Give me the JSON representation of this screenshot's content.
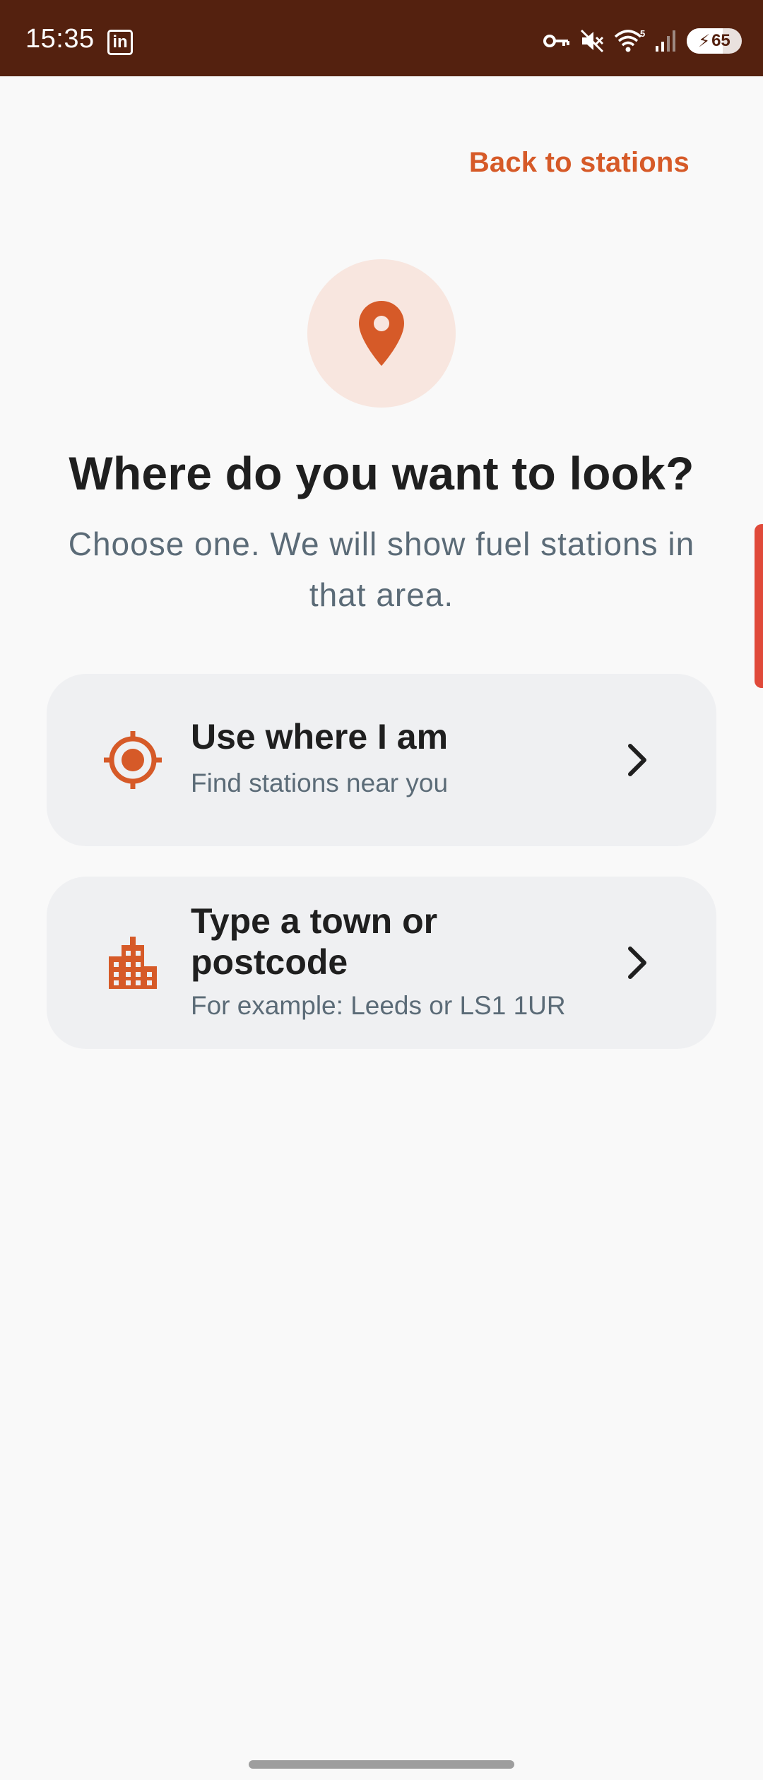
{
  "status_bar": {
    "time": "15:35",
    "app_icon": "linkedin-icon",
    "linkedin_glyph": "in",
    "icons": [
      "vpn-key-icon",
      "mute-icon",
      "wifi-icon",
      "signal-icon"
    ],
    "wifi_badge": "5",
    "battery_level": "65"
  },
  "header": {
    "back_link": "Back to stations"
  },
  "hero": {
    "icon": "location-pin-icon",
    "title": "Where do you want to look?",
    "subtitle": "Choose one. We will show fuel stations in that area."
  },
  "options": [
    {
      "icon": "crosshair-location-icon",
      "title": "Use where I am",
      "subtitle": "Find stations near you"
    },
    {
      "icon": "city-buildings-icon",
      "title": "Type a town or postcode",
      "subtitle": "For example: Leeds or LS1 1UR"
    }
  ],
  "colors": {
    "accent": "#d65a28",
    "status_bar_bg": "#54210f",
    "card_bg": "#eff0f2",
    "pin_circle_bg": "#f8e6df"
  }
}
